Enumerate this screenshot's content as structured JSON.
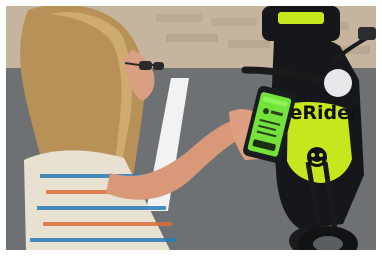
{
  "photo": {
    "scooter_brand_text": "BeRider"
  },
  "colors": {
    "brand_green": "#c8e61e",
    "phone_screen_green": "#73e23a",
    "scooter_black": "#15171a",
    "asphalt": "#6d7174",
    "wall": "#c6b59e"
  },
  "icons": {
    "brand_mark": "berider-logo-icon"
  }
}
